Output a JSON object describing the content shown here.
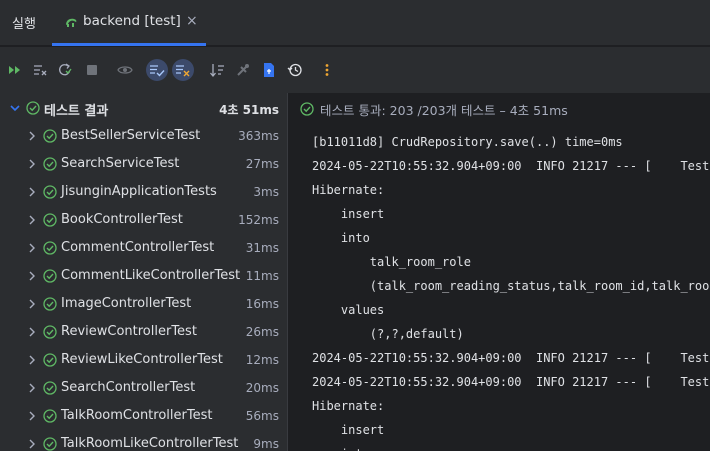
{
  "tabs": {
    "run_label": "실행",
    "active_label": "backend [test]",
    "close": "×"
  },
  "toolbar": {
    "icons": [
      "rerun-icon",
      "rerun-failed-icon",
      "toggle-auto-test-icon",
      "stop-icon",
      "show-passed-icon",
      "show-ignored-icon",
      "sort-icon",
      "import-tests-icon",
      "export-icon",
      "history-icon",
      "more-icon"
    ]
  },
  "tree": {
    "root": {
      "label": "테스트 결과",
      "time": "4초 51ms"
    },
    "items": [
      {
        "label": "BestSellerServiceTest",
        "time": "363ms"
      },
      {
        "label": "SearchServiceTest",
        "time": "27ms"
      },
      {
        "label": "JisunginApplicationTests",
        "time": "3ms"
      },
      {
        "label": "BookControllerTest",
        "time": "152ms"
      },
      {
        "label": "CommentControllerTest",
        "time": "31ms"
      },
      {
        "label": "CommentLikeControllerTest",
        "time": "11ms"
      },
      {
        "label": "ImageControllerTest",
        "time": "16ms"
      },
      {
        "label": "ReviewControllerTest",
        "time": "26ms"
      },
      {
        "label": "ReviewLikeControllerTest",
        "time": "12ms"
      },
      {
        "label": "SearchControllerTest",
        "time": "20ms"
      },
      {
        "label": "TalkRoomControllerTest",
        "time": "56ms"
      },
      {
        "label": "TalkRoomLikeControllerTest",
        "time": "9ms"
      }
    ]
  },
  "console": {
    "status": "테스트 통과: 203 /203개 테스트 – 4초 51ms",
    "lines": [
      "[b11011d8] CrudRepository.save(..) time=0ms",
      "2024-05-22T10:55:32.904+09:00  INFO 21217 --- [    Test",
      "Hibernate:",
      "    insert",
      "    into",
      "        talk_room_role",
      "        (talk_room_reading_status,talk_room_id,talk_room",
      "    values",
      "        (?,?,default)",
      "2024-05-22T10:55:32.904+09:00  INFO 21217 --- [    Test",
      "2024-05-22T10:55:32.904+09:00  INFO 21217 --- [    Test",
      "Hibernate:",
      "    insert",
      "    into"
    ]
  },
  "colors": {
    "accent": "#3574f0",
    "pass": "#5fb865",
    "run": "#5fb865",
    "more": "#f0a732",
    "docs": "#3574f0"
  }
}
